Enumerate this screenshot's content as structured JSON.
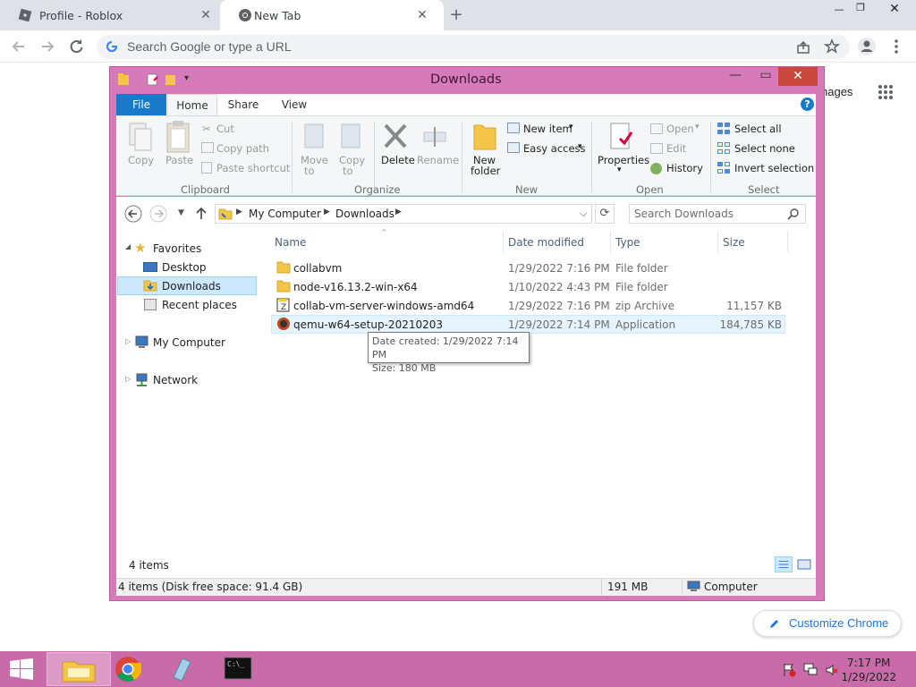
{
  "browser": {
    "tabs": [
      {
        "title": "Profile - Roblox",
        "icon": "roblox-icon"
      },
      {
        "title": "New Tab",
        "icon": "chrome-icon"
      }
    ],
    "omnibox_placeholder": "Search Google or type a URL",
    "images_partial": "nages",
    "customize_label": "Customize Chrome"
  },
  "explorer": {
    "title": "Downloads",
    "ribbon_tabs": [
      "File",
      "Home",
      "Share",
      "View"
    ],
    "clipboard": {
      "copy": "Copy",
      "paste": "Paste",
      "cut": "Cut",
      "copy_path": "Copy path",
      "paste_shortcut": "Paste shortcut",
      "group": "Clipboard"
    },
    "organize": {
      "move_to": "Move",
      "move_to_2": "to",
      "copy_to": "Copy",
      "copy_to_2": "to",
      "delete": "Delete",
      "rename": "Rename",
      "group": "Organize"
    },
    "new": {
      "new_folder": "New",
      "new_folder_2": "folder",
      "new_item": "New item",
      "easy_access": "Easy access",
      "group": "New"
    },
    "open": {
      "properties": "Properties",
      "open": "Open",
      "edit": "Edit",
      "history": "History",
      "group": "Open"
    },
    "select": {
      "select_all": "Select all",
      "select_none": "Select none",
      "invert": "Invert selection",
      "group": "Select"
    },
    "breadcrumb": [
      "My Computer",
      "Downloads"
    ],
    "search_placeholder": "Search Downloads",
    "nav": {
      "favorites": "Favorites",
      "desktop": "Desktop",
      "downloads": "Downloads",
      "recent": "Recent places",
      "computer": "My Computer",
      "network": "Network"
    },
    "columns": [
      "Name",
      "Date modified",
      "Type",
      "Size"
    ],
    "files": [
      {
        "name": "collabvm",
        "date": "1/29/2022 7:16 PM",
        "type": "File folder",
        "size": "",
        "icon": "folder-icon"
      },
      {
        "name": "node-v16.13.2-win-x64",
        "date": "1/10/2022 4:43 PM",
        "type": "File folder",
        "size": "",
        "icon": "folder-icon"
      },
      {
        "name": "collab-vm-server-windows-amd64",
        "date": "1/29/2022 7:16 PM",
        "type": "zip Archive",
        "size": "11,157 KB",
        "icon": "zip-icon"
      },
      {
        "name": "qemu-w64-setup-20210203",
        "date": "1/29/2022 7:14 PM",
        "type": "Application",
        "size": "184,785 KB",
        "icon": "app-icon"
      }
    ],
    "tooltip": {
      "line1": "Date created: 1/29/2022 7:14 PM",
      "line2": "Size: 180 MB"
    },
    "item_count": "4 items",
    "status": {
      "left": "4 items (Disk free space: 91.4 GB)",
      "size": "191 MB",
      "location": "Computer"
    }
  },
  "taskbar": {
    "time": "7:17 PM",
    "date": "1/29/2022"
  },
  "colors": {
    "explorer_frame": "#d77ab9",
    "taskbar": "#c86ba8",
    "accent": "#1979ca",
    "close": "#c9473d"
  }
}
